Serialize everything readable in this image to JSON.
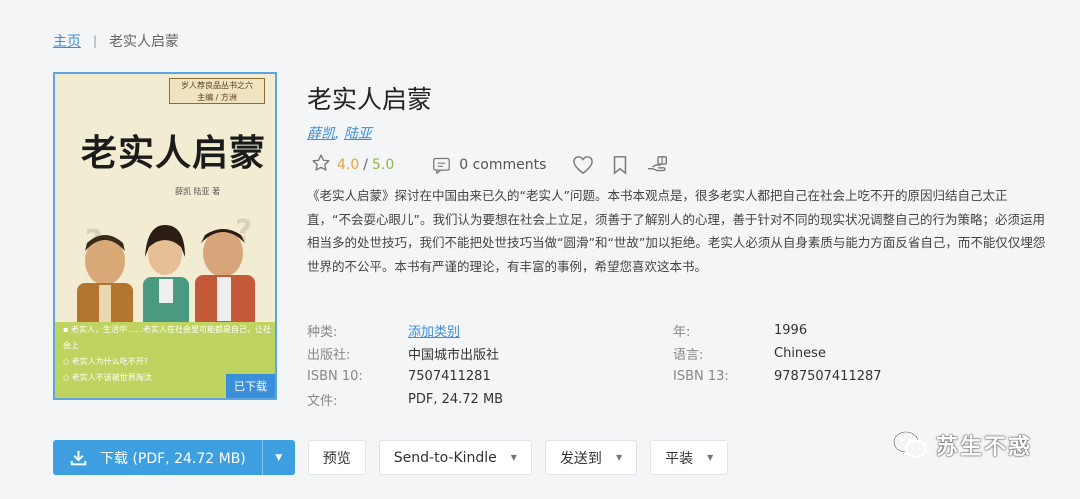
{
  "breadcrumb": {
    "home": "主页",
    "separator": "|",
    "current": "老实人启蒙"
  },
  "cover": {
    "series_tag_line1": "岁人荐良品丛书之六",
    "series_tag_line2": "主编 / 方洲",
    "title": "老实人启蒙",
    "authors": "薛凯  陆亚 著",
    "band_lines": [
      "▪ 老实人，生活中……老实人在社会里可能都是自己，让社会上",
      "◇ 老实人为什么吃不开?",
      "◇ 老实人不该被世界淘汰"
    ],
    "downloaded_badge": "已下载"
  },
  "book": {
    "title": "老实人启蒙",
    "authors": [
      "薛凯",
      "陆亚"
    ],
    "author_sep": ", ",
    "rating": "4.0",
    "rating_sep": "/",
    "rating_max": "5.0",
    "comments": "0 comments",
    "description": "《老实人启蒙》探讨在中国由来已久的“老实人”问题。本书本观点是，很多老实人都把自己在社会上吃不开的原因归结自己太正直，“不会耍心眼儿”。我们认为要想在社会上立足，须善于了解别人的心理，善于针对不同的现实状况调整自己的行为策略；必须运用相当多的处世技巧，我们不能把处世技巧当做“圆滑”和“世故”加以拒绝。老实人必须从自身素质与能力方面反省自己，而不能仅仅埋怨世界的不公平。本书有严谨的理论，有丰富的事例，希望您喜欢这本书。"
  },
  "details": {
    "left": [
      {
        "key": "种类:",
        "value": "添加类别",
        "link": true
      },
      {
        "key": "出版社:",
        "value": "中国城市出版社"
      },
      {
        "key": "ISBN 10:",
        "value": "7507411281"
      },
      {
        "key": "文件:",
        "value": "PDF, 24.72 MB"
      }
    ],
    "right": [
      {
        "key": "年:",
        "value": "1996"
      },
      {
        "key": "语言:",
        "value": "Chinese"
      },
      {
        "key": "ISBN 13:",
        "value": "9787507411287"
      }
    ]
  },
  "actions": {
    "download": "下载 (PDF, 24.72 MB)",
    "preview": "预览",
    "send_to_kindle": "Send-to-Kindle",
    "send_to": "发送到",
    "binding": "平装"
  },
  "watermark": {
    "text": "苏生不惑"
  },
  "colors": {
    "accent": "#3d9fe0",
    "link": "#3b8ed8",
    "rating": "#e8a43a",
    "rating_max": "#8ab84a"
  }
}
